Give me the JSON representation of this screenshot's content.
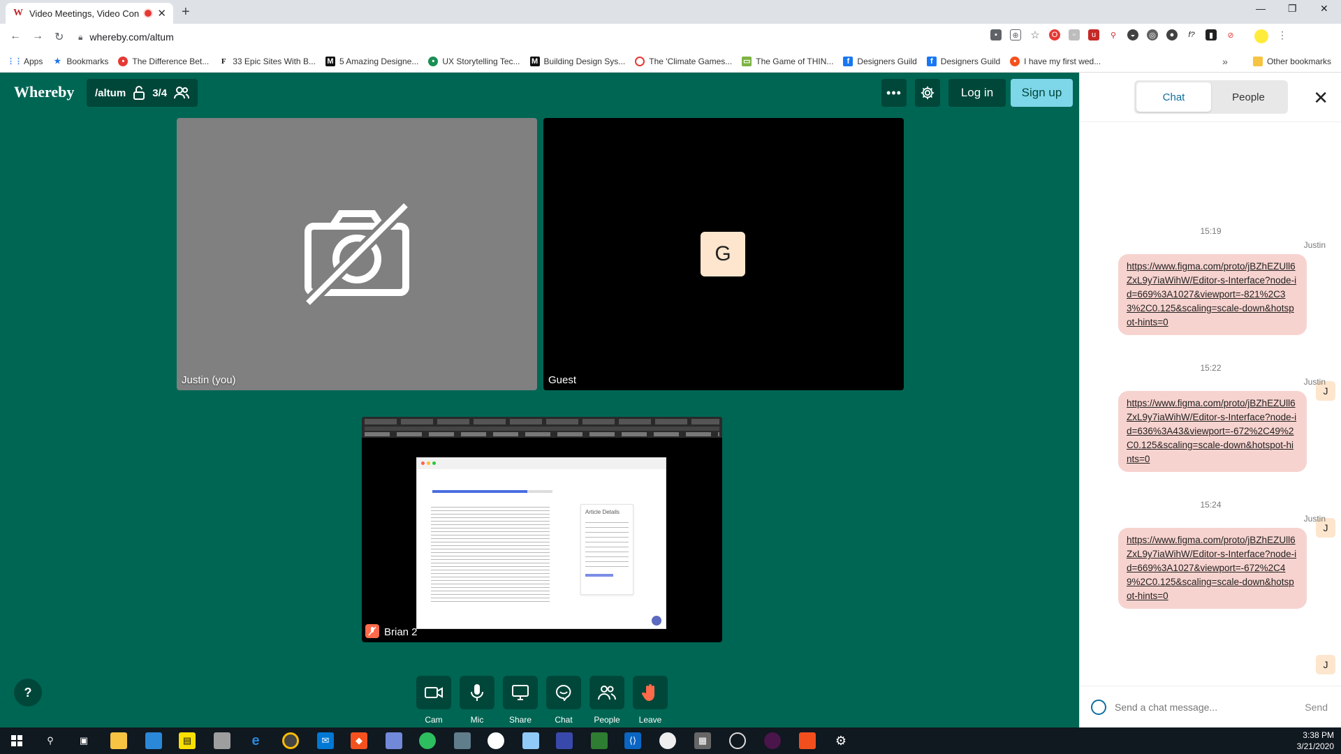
{
  "browser": {
    "tab_title": "Video Meetings, Video Confe",
    "url": "whereby.com/altum",
    "bookmarks": [
      {
        "label": "Apps",
        "icon": "apps-grid-icon",
        "color": "#4285f4"
      },
      {
        "label": "Bookmarks",
        "icon": "star-icon",
        "color": "#1a73e8"
      },
      {
        "label": "The Difference Bet...",
        "icon": "site-icon",
        "color": "#e53935"
      },
      {
        "label": "33 Epic Sites With B...",
        "icon": "f-logo-icon",
        "color": "#111111"
      },
      {
        "label": "5 Amazing Designe...",
        "icon": "m-logo-icon",
        "color": "#111111"
      },
      {
        "label": "UX Storytelling Tec...",
        "icon": "globe-icon",
        "color": "#1b8f55"
      },
      {
        "label": "Building Design Sys...",
        "icon": "m-logo-icon",
        "color": "#111111"
      },
      {
        "label": "The 'Climate Games...",
        "icon": "chat-bubble-icon",
        "color": "#e53935"
      },
      {
        "label": "The Game of THIN...",
        "icon": "site-icon",
        "color": "#7cb342"
      },
      {
        "label": "Designers Guild",
        "icon": "facebook-icon",
        "color": "#1877f2"
      },
      {
        "label": "Designers Guild",
        "icon": "facebook-icon",
        "color": "#1877f2"
      },
      {
        "label": "I have my first wed...",
        "icon": "site-icon",
        "color": "#f4511e"
      }
    ],
    "bookmarks_overflow": "»",
    "other_bookmarks": "Other bookmarks"
  },
  "app": {
    "brand": "Whereby",
    "room_name": "/altum",
    "participant_count": "3/4",
    "login_label": "Log in",
    "signup_label": "Sign up",
    "accent_color": "#006654",
    "dark_accent": "#00473a",
    "signup_color": "#7ed6e9"
  },
  "tiles": [
    {
      "label": "Justin (you)",
      "state": "camera-off"
    },
    {
      "label": "Guest",
      "avatar_letter": "G"
    },
    {
      "label": "Brian 2",
      "state": "screen-share"
    }
  ],
  "shared_screen": {
    "doc_heading": "Article Details"
  },
  "toolbar": [
    {
      "label": "Cam",
      "icon": "camera-icon"
    },
    {
      "label": "Mic",
      "icon": "microphone-icon"
    },
    {
      "label": "Share",
      "icon": "monitor-icon"
    },
    {
      "label": "Chat",
      "icon": "chat-icon"
    },
    {
      "label": "People",
      "icon": "people-icon"
    },
    {
      "label": "Leave",
      "icon": "wave-hand-icon"
    }
  ],
  "help_label": "?",
  "chat": {
    "tabs": [
      "Chat",
      "People"
    ],
    "messages": [
      {
        "time": "15:19",
        "sender": "Justin",
        "text": "https://www.figma.com/proto/jBZhEZUll6ZxL9y7iaWihW/Editor-s-Interface?node-id=669%3A1027&viewport=-821%2C33%2C0.125&scaling=scale-down&hotspot-hints=0",
        "badge": "J"
      },
      {
        "time": "15:22",
        "sender": "Justin",
        "text": "https://www.figma.com/proto/jBZhEZUll6ZxL9y7iaWihW/Editor-s-Interface?node-id=636%3A43&viewport=-672%2C49%2C0.125&scaling=scale-down&hotspot-hints=0",
        "badge": "J"
      },
      {
        "time": "15:24",
        "sender": "Justin",
        "text": "https://www.figma.com/proto/jBZhEZUll6ZxL9y7iaWihW/Editor-s-Interface?node-id=669%3A1027&viewport=-672%2C49%2C0.125&scaling=scale-down&hotspot-hints=0",
        "badge": "J"
      }
    ],
    "input_placeholder": "Send a chat message...",
    "send_label": "Send"
  },
  "taskbar": {
    "time": "3:38 PM",
    "date": "3/21/2020"
  }
}
